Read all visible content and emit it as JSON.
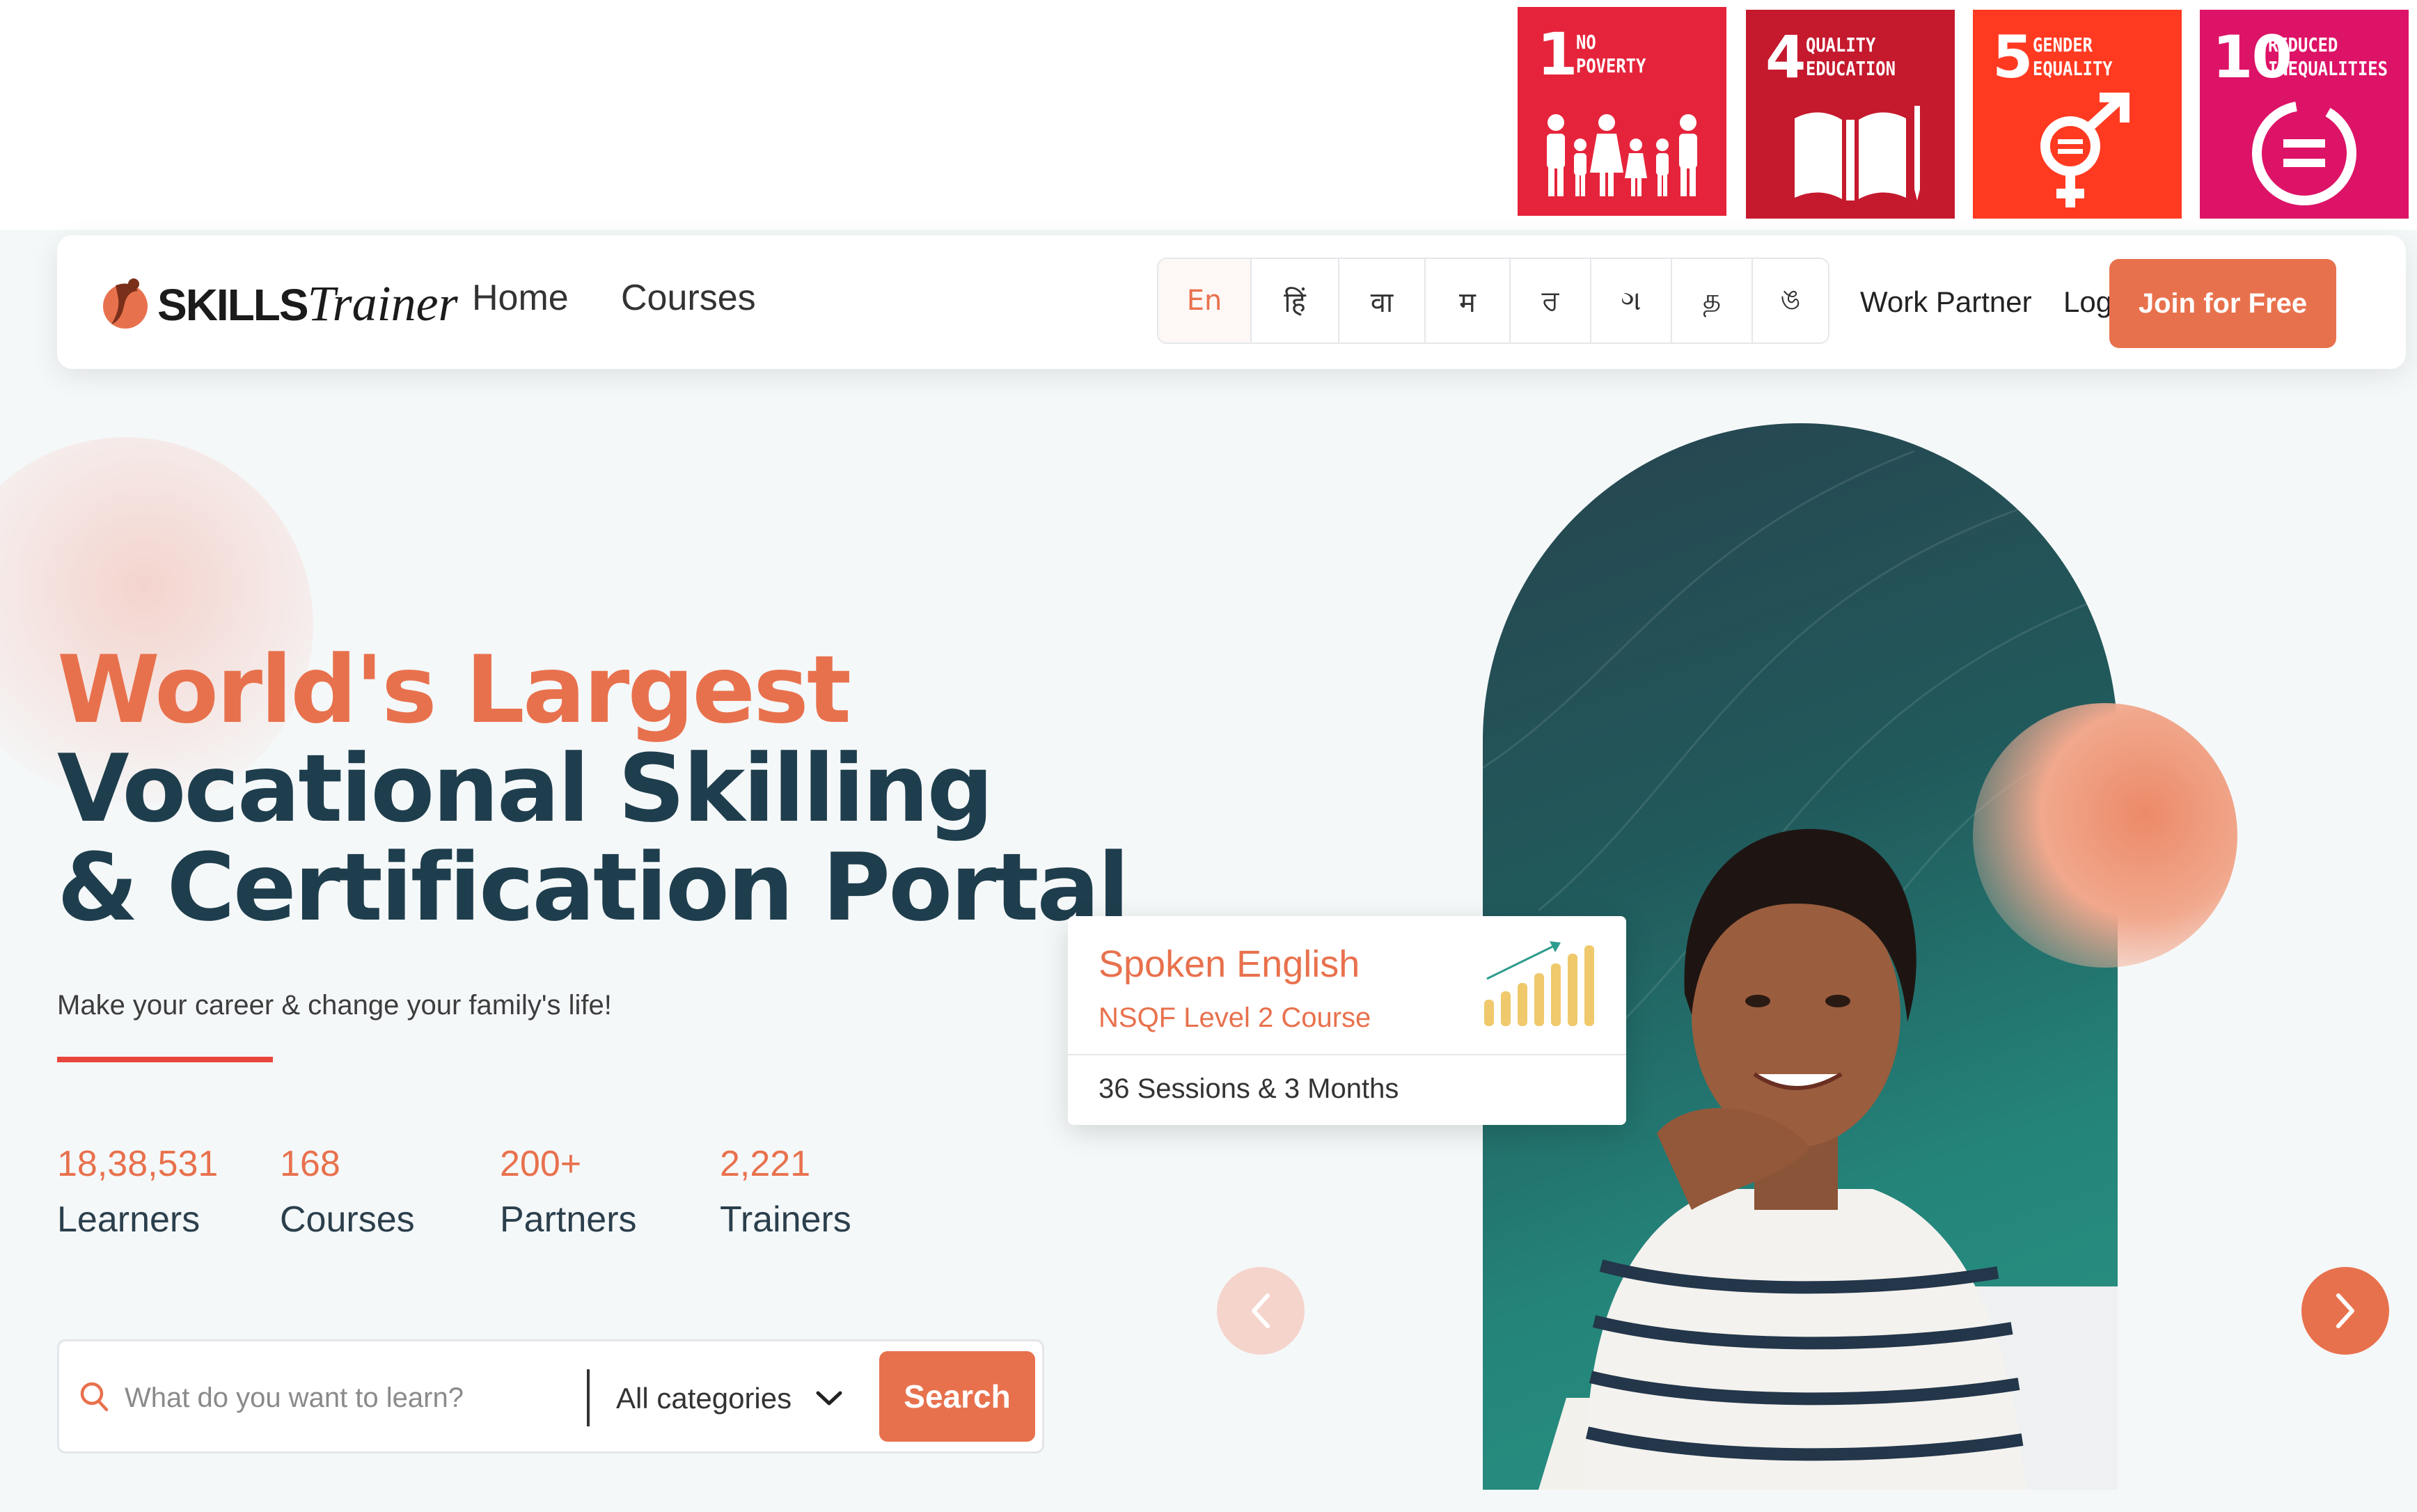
{
  "sdg_goals": [
    {
      "number": "1",
      "title_line1": "NO",
      "title_line2": "POVERTY",
      "color": "#e5243b"
    },
    {
      "number": "4",
      "title_line1": "QUALITY",
      "title_line2": "EDUCATION",
      "color": "#c5192d"
    },
    {
      "number": "5",
      "title_line1": "GENDER",
      "title_line2": "EQUALITY",
      "color": "#ff3a21"
    },
    {
      "number": "10",
      "title_line1": "REDUCED",
      "title_line2": "INEQUALITIES",
      "color": "#dd1367"
    }
  ],
  "header": {
    "logo_skills": "SKILLS",
    "logo_trainer": "Trainer",
    "nav": {
      "home": "Home",
      "courses": "Courses"
    },
    "languages": [
      "En",
      "हिं",
      "वा",
      "म",
      "ਰ",
      "ગ",
      "த",
      "ঙ"
    ],
    "active_language": "En",
    "work_partner": "Work Partner",
    "login": "Login",
    "join": "Join for Free"
  },
  "hero": {
    "line1": "World's Largest",
    "line2": "Vocational Skilling",
    "line3": "& Certification Portal",
    "tagline": "Make your career & change your family's life!"
  },
  "stats": [
    {
      "value": "18,38,531",
      "label": "Learners"
    },
    {
      "value": "168",
      "label": "Courses"
    },
    {
      "value": "200+",
      "label": "Partners"
    },
    {
      "value": "2,221",
      "label": "Trainers"
    }
  ],
  "search": {
    "placeholder": "What do you want to learn?",
    "category": "All categories",
    "button": "Search"
  },
  "course_card": {
    "title": "Spoken English",
    "subtitle": "NSQF Level 2 Course",
    "footer": "36 Sessions & 3 Months"
  },
  "colors": {
    "accent": "#e8714d",
    "dark_heading": "#1f3e4d",
    "teal_bg": "#24847a"
  }
}
